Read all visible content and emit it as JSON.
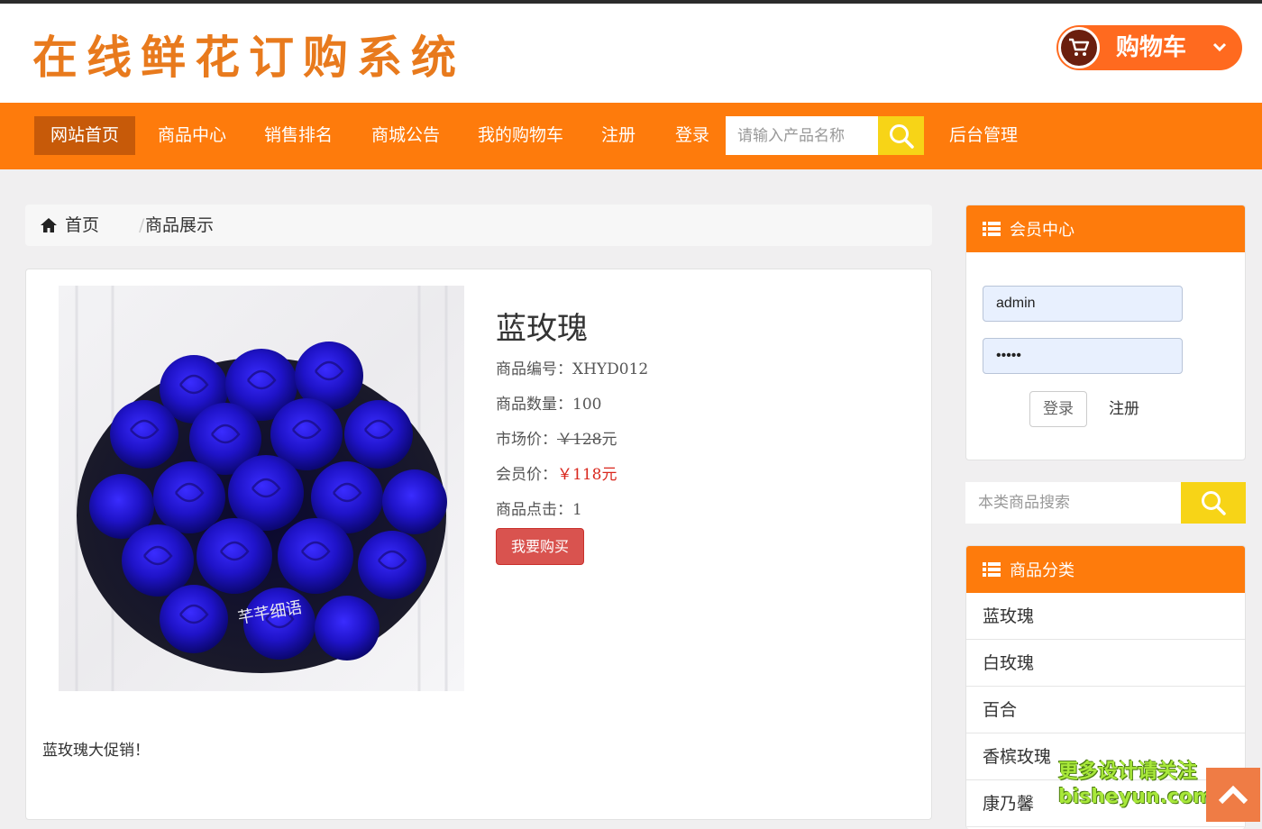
{
  "site": {
    "logo_text": "在线鲜花订购系统",
    "cart_label": "购物车"
  },
  "nav": {
    "items": [
      "网站首页",
      "商品中心",
      "销售排名",
      "商城公告",
      "我的购物车",
      "注册",
      "登录"
    ],
    "search_placeholder": "请输入产品名称",
    "admin_label": "后台管理"
  },
  "breadcrumb": {
    "home": "首页",
    "current": "商品展示"
  },
  "product": {
    "name": "蓝玫瑰",
    "code_row": "商品编号：XHYD012",
    "qty_row": "商品数量：100",
    "market_label": "市场价：",
    "market_price": "￥128",
    "market_unit": "元",
    "member_label": "会员价：",
    "member_price": "￥118元",
    "clicks_row": "商品点击：1",
    "buy_label": "我要购买",
    "description": "蓝玫瑰大促销！",
    "image_signature": "芊芊细语"
  },
  "member": {
    "title": "会员中心",
    "username": "admin",
    "password": "•••••",
    "login_label": "登录",
    "register_label": "注册"
  },
  "category_search": {
    "placeholder": "本类商品搜索"
  },
  "categories": {
    "title": "商品分类",
    "items": [
      "蓝玫瑰",
      "白玫瑰",
      "百合",
      "香槟玫瑰",
      "康乃馨"
    ]
  },
  "watermark": {
    "line1": "更多设计请关注",
    "line2": "bisheyun.com"
  },
  "colors": {
    "nav_orange": "#fe7b0c",
    "search_yellow": "#f7d417",
    "buy_red": "#d9534f",
    "price_red": "#d9261c"
  },
  "icons": [
    "cart-icon",
    "chevron-down-icon",
    "search-icon",
    "home-icon",
    "list-icon",
    "arrow-up-icon"
  ]
}
